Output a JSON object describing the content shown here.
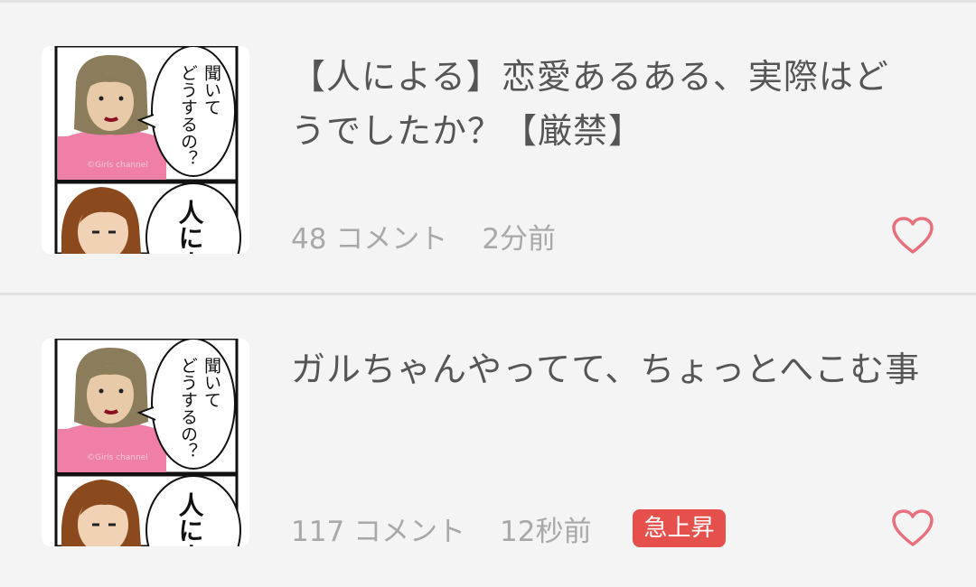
{
  "colors": {
    "background": "#f4f4f4",
    "title_text": "#555555",
    "meta_text": "#a8a8a8",
    "heart": "#e8707c",
    "badge_bg": "#e5504c"
  },
  "topics": [
    {
      "title": "【人による】恋愛あるある、実際はどうでしたか？【厳禁】",
      "comments": "48 コメント",
      "time": "2分前",
      "badge": "",
      "thumbnail": {
        "bubble_top": "聞いてどうするの？",
        "bubble_bottom": "人によ",
        "watermark": "©Girls channel"
      },
      "favorite_icon": "heart-outline-icon"
    },
    {
      "title": "ガルちゃんやってて、ちょっとへこむ事",
      "comments": "117 コメント",
      "time": "12秒前",
      "badge": "急上昇",
      "thumbnail": {
        "bubble_top": "聞いてどうするの？",
        "bubble_bottom": "人によ",
        "watermark": "©Girls channel"
      },
      "favorite_icon": "heart-outline-icon"
    }
  ]
}
